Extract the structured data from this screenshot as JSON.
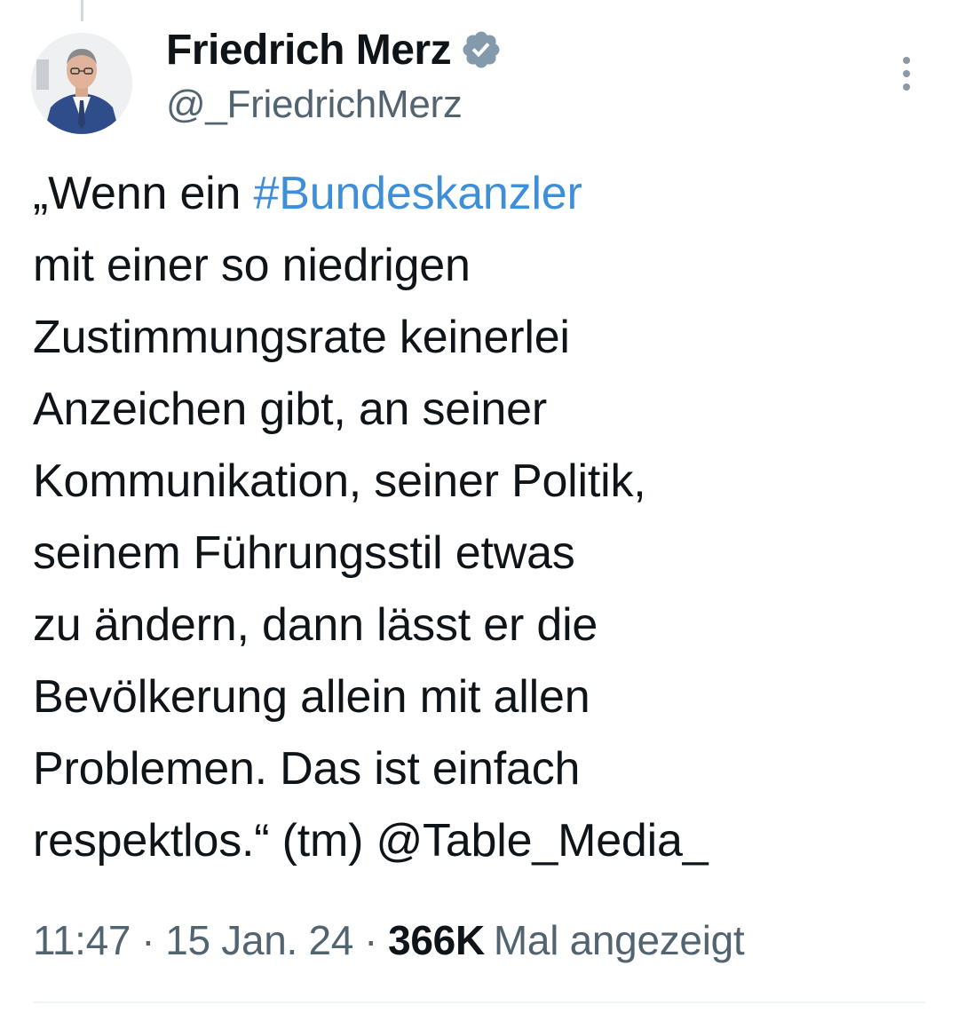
{
  "author": {
    "display_name": "Friedrich Merz",
    "handle": "@_FriedrichMerz",
    "verified_icon": "verified-badge-icon",
    "verified_color": "#829aab"
  },
  "tweet": {
    "lines": [
      {
        "prefix": "„Wenn ein ",
        "hashtag": "#Bundeskanzler"
      },
      {
        "text": "mit einer so niedrigen"
      },
      {
        "text": "Zustimmungsrate keinerlei"
      },
      {
        "text": "Anzeichen gibt, an seiner"
      },
      {
        "text": "Kommunikation, seiner Politik,"
      },
      {
        "text": "seinem Führungsstil etwas"
      },
      {
        "text": "zu ändern, dann lässt er die"
      },
      {
        "text": "Bevölkerung allein mit allen"
      },
      {
        "text": "Problemen. Das ist einfach"
      },
      {
        "prefix": "respektlos.“ (tm) ",
        "mention": "@Table_Media_"
      }
    ],
    "link_color": "#3f8fd8"
  },
  "meta": {
    "time": "11:47",
    "separator": "·",
    "date": "15 Jan. 24",
    "views_count": "366K",
    "views_label": "Mal angezeigt"
  },
  "icons": {
    "more": "more-options-icon",
    "avatar": "avatar-photo"
  }
}
